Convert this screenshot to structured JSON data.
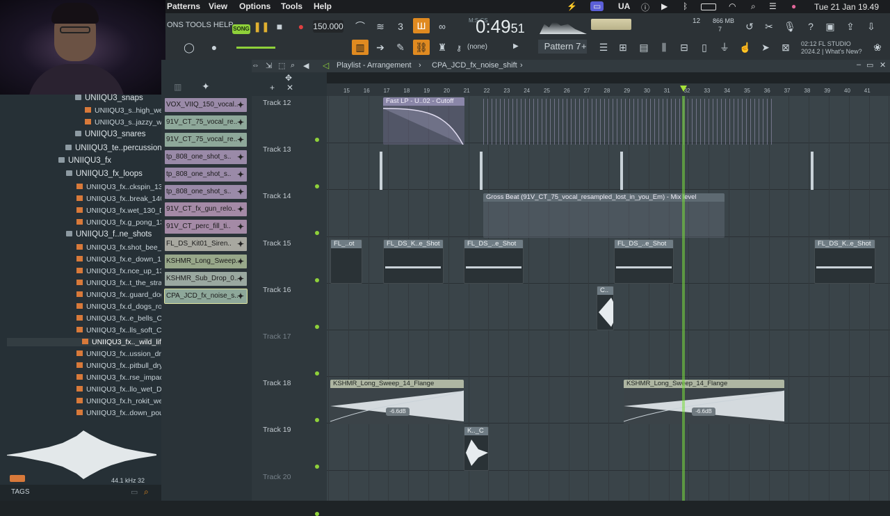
{
  "menubar": {
    "menus": [
      "Patterns",
      "View",
      "Options",
      "Tools",
      "Help"
    ],
    "input_source": "UA",
    "clock": "Tue 21 Jan  19.49",
    "icons": [
      "fl-icon",
      "screen-record-icon",
      "info-icon",
      "play-circle-icon",
      "bluetooth-icon",
      "battery-icon",
      "wifi-icon",
      "spotlight-icon",
      "control-center-icon",
      "siri-icon"
    ]
  },
  "toolbar": {
    "hint_text": "ONS TOOLS HELP",
    "song_label": "SONG",
    "tempo": "150.000",
    "time_display": "0:49",
    "time_sub": "51",
    "time_units": "M:S:CS",
    "cpu_num": "12",
    "mem_value": "866 MB",
    "mem_sub": "7",
    "snap_label": "(none)",
    "pattern": "Pattern 7",
    "fl_line1": "02:12  FL STUDIO",
    "fl_line2": "2024.2 | What's New?"
  },
  "playlist": {
    "breadcrumb_root": "Playlist - Arrangement",
    "breadcrumb_item": "CPA_JCD_fx_noise_shift",
    "ruler": [
      "15",
      "16",
      "17",
      "18",
      "19",
      "20",
      "21",
      "22",
      "23",
      "24",
      "25",
      "26",
      "27",
      "28",
      "29",
      "30",
      "31",
      "32",
      "33",
      "34",
      "35",
      "36",
      "37",
      "38",
      "39",
      "40",
      "41"
    ]
  },
  "browser": {
    "items": [
      {
        "label": "UNIIQU3_snaps",
        "kind": "folder"
      },
      {
        "label": "UNIIQU3_s..high_wet",
        "kind": "audio"
      },
      {
        "label": "UNIIQU3_s..jazzy_wet",
        "kind": "audio"
      },
      {
        "label": "UNIIQU3_snares",
        "kind": "folder"
      },
      {
        "label": "UNIIQU3_te..percussion",
        "kind": "folder"
      },
      {
        "label": "UNIIQU3_fx",
        "kind": "folder"
      },
      {
        "label": "UNIIQU3_fx_loops",
        "kind": "folder"
      },
      {
        "label": "UNIIQU3_fx..ckspin_130",
        "kind": "audio"
      },
      {
        "label": "UNIIQU3_fx..break_140",
        "kind": "audio"
      },
      {
        "label": "UNIIQU3_fx.wet_130_D#",
        "kind": "audio"
      },
      {
        "label": "UNIIQU3_fx.g_pong_135",
        "kind": "audio"
      },
      {
        "label": "UNIIQU3_f..ne_shots",
        "kind": "folder"
      },
      {
        "label": "UNIIQU3_fx.shot_bee_D",
        "kind": "audio"
      },
      {
        "label": "UNIIQU3_fx.e_down_132",
        "kind": "audio"
      },
      {
        "label": "UNIIQU3_fx.nce_up_132",
        "kind": "audio"
      },
      {
        "label": "UNIIQU3_fx..t_the_strap",
        "kind": "audio"
      },
      {
        "label": "UNIIQU3_fx..guard_dogs",
        "kind": "audio"
      },
      {
        "label": "UNIIQU3_fx.d_dogs_roar",
        "kind": "audio"
      },
      {
        "label": "UNIIQU3_fx..e_bells_C#",
        "kind": "audio"
      },
      {
        "label": "UNIIQU3_fx..lls_soft_C#",
        "kind": "audio"
      },
      {
        "label": "UNIIQU3_fx.._wild_life",
        "kind": "audio"
      },
      {
        "label": "UNIIQU3_fx..ussion_dry",
        "kind": "audio"
      },
      {
        "label": "UNIIQU3_fx..pitbull_dry",
        "kind": "audio"
      },
      {
        "label": "UNIIQU3_fx..rse_impact",
        "kind": "audio"
      },
      {
        "label": "UNIIQU3_fx..llo_wet_D#",
        "kind": "audio"
      },
      {
        "label": "UNIIQU3_fx.h_rokit_wet",
        "kind": "audio"
      },
      {
        "label": "UNIIQU3_fx..down_pour",
        "kind": "audio"
      }
    ],
    "sample_rate": "44.1 kHz 32",
    "tags_label": "TAGS"
  },
  "channels": [
    {
      "label": "VOX_VIIQ_150_vocal..",
      "color": "#9a8aa8"
    },
    {
      "label": "91V_CT_75_vocal_re..",
      "color": "#8ea89a"
    },
    {
      "label": "91V_CT_75_vocal_re..",
      "color": "#8ea89a"
    },
    {
      "label": "tp_808_one_shot_s..",
      "color": "#9a8aa8"
    },
    {
      "label": "tp_808_one_shot_s..",
      "color": "#9a8aa8"
    },
    {
      "label": "tp_808_one_shot_s..",
      "color": "#9a8aa8"
    },
    {
      "label": "91V_CT_fx_gun_relo..",
      "color": "#a48aa6"
    },
    {
      "label": "91V_CT_perc_fill_ti..",
      "color": "#a48aa6"
    },
    {
      "label": "FL_DS_Kit01_Siren..",
      "color": "#a8a8a0"
    },
    {
      "label": "KSHMR_Long_Sweep..",
      "color": "#98a88a"
    },
    {
      "label": "KSHMR_Sub_Drop_0..",
      "color": "#9aa8a0"
    },
    {
      "label": "CPA_JCD_fx_noise_s..",
      "color": "#8ea89a"
    }
  ],
  "tracks": [
    "Track 12",
    "Track 13",
    "Track 14",
    "Track 15",
    "Track 16",
    "Track 17",
    "Track 18",
    "Track 19",
    "Track 20"
  ],
  "clips": {
    "t12_auto": "Fast LP - U..02 - Cutoff",
    "t14_auto": "Gross Beat (91V_CT_75_vocal_resampled_lost_in_you_Em) - Mix level",
    "t15_a": "FL_..ot",
    "t15_b": "FL_DS_K..e_Shot",
    "t15_c": "FL_DS_..e_Shot",
    "t15_d": "FL_DS_..e_Shot",
    "t15_e": "FL_DS_K..e_Shot",
    "t16": "C..",
    "t18_a": "KSHMR_Long_Sweep_14_Flange",
    "t18_b": "KSHMR_Long_Sweep_14_Flange",
    "t18_gain": "-6.6dB",
    "t19": "K.._C"
  }
}
